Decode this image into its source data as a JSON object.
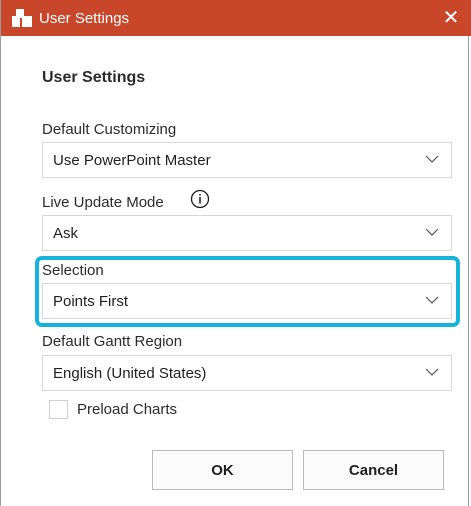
{
  "window": {
    "title": "User Settings",
    "close_glyph": "✕",
    "icon": "app-icon"
  },
  "heading": "User Settings",
  "fields": [
    {
      "label": "Default Customizing",
      "value": "Use PowerPoint Master"
    },
    {
      "label": "Live Update Mode",
      "value": "Ask",
      "info_icon": "info-icon"
    },
    {
      "label": "Selection",
      "value": "Points First",
      "highlighted": true
    },
    {
      "label": "Default Gantt Region",
      "value": "English (United States)"
    }
  ],
  "preload": {
    "label": "Preload Charts",
    "checked": false
  },
  "buttons": {
    "ok": "OK",
    "cancel": "Cancel"
  },
  "colors": {
    "titlebar": "#c8472a",
    "highlight": "#17b3d8"
  }
}
